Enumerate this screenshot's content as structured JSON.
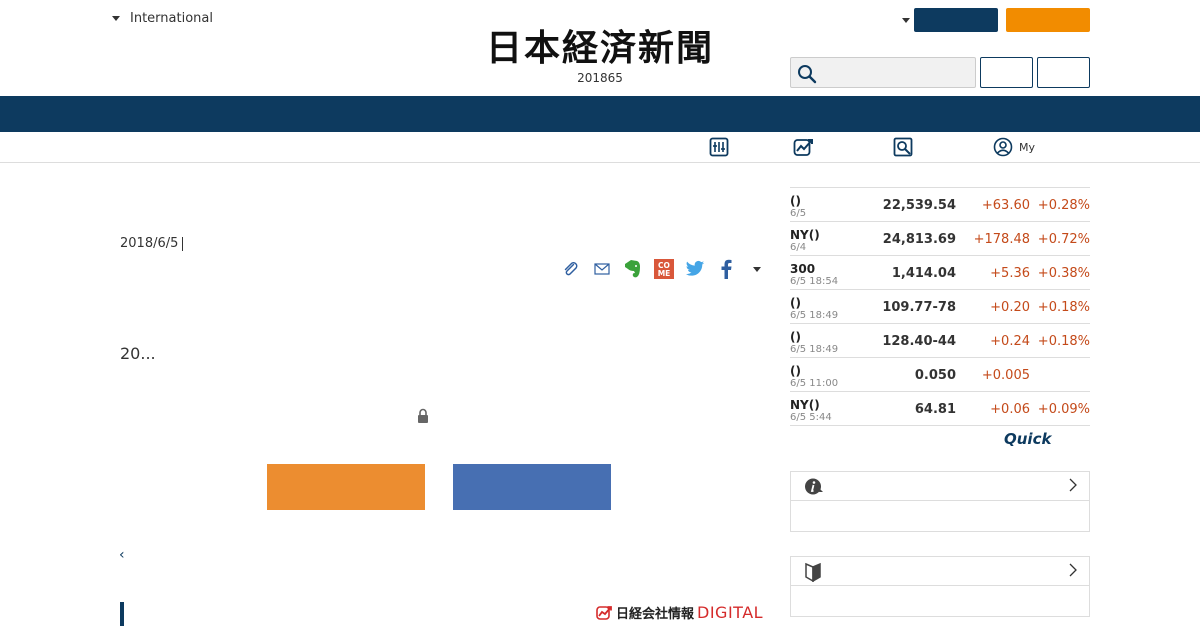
{
  "header": {
    "region_label": "International",
    "logo_text": "日本経済新聞",
    "logo_subtext": "201865",
    "search_placeholder": ""
  },
  "subnav": {
    "my_label": "My"
  },
  "article": {
    "date": "2018/6/5",
    "lead": "20...",
    "back_link": "‹"
  },
  "footer_brand": {
    "jp": "日経会社情報",
    "digital": "DIGITAL"
  },
  "market": {
    "rows": [
      {
        "name": "()",
        "when": "6/5",
        "value": "22,539.54",
        "change": "+63.60",
        "pct": "+0.28%"
      },
      {
        "name": "NY()",
        "when": "6/4",
        "value": "24,813.69",
        "change": "+178.48",
        "pct": "+0.72%"
      },
      {
        "name": "300",
        "when": "6/5 18:54",
        "value": "1,414.04",
        "change": "+5.36",
        "pct": "+0.38%"
      },
      {
        "name": "()",
        "when": "6/5 18:49",
        "value": "109.77-78",
        "change": "+0.20",
        "pct": "+0.18%"
      },
      {
        "name": "()",
        "when": "6/5 18:49",
        "value": "128.40-44",
        "change": "+0.24",
        "pct": "+0.18%"
      },
      {
        "name": "()",
        "when": "6/5 11:00",
        "value": "0.050",
        "change": "+0.005",
        "pct": ""
      },
      {
        "name": "NY()",
        "when": "6/5 5:44",
        "value": "64.81",
        "change": "+0.06",
        "pct": "+0.09%"
      }
    ],
    "provider": "Quick"
  },
  "colors": {
    "navy": "#0d3a5f",
    "orange": "#f28c00",
    "cta_orange": "#ec8d30",
    "cta_blue": "#476fb2",
    "up": "#c44a1a"
  },
  "icons": {
    "region_toggle": "caret-down-icon",
    "search": "search-icon",
    "share": [
      "clip-icon",
      "mail-icon",
      "evernote-icon",
      "comemo-icon",
      "twitter-icon",
      "facebook-icon",
      "more-caret-icon"
    ],
    "subnav": [
      "data-panel-icon",
      "chart-trend-icon",
      "screen-search-icon",
      "user-icon"
    ],
    "lock": "lock-icon",
    "panels": [
      "info-icon",
      "beginner-mark-icon"
    ]
  }
}
